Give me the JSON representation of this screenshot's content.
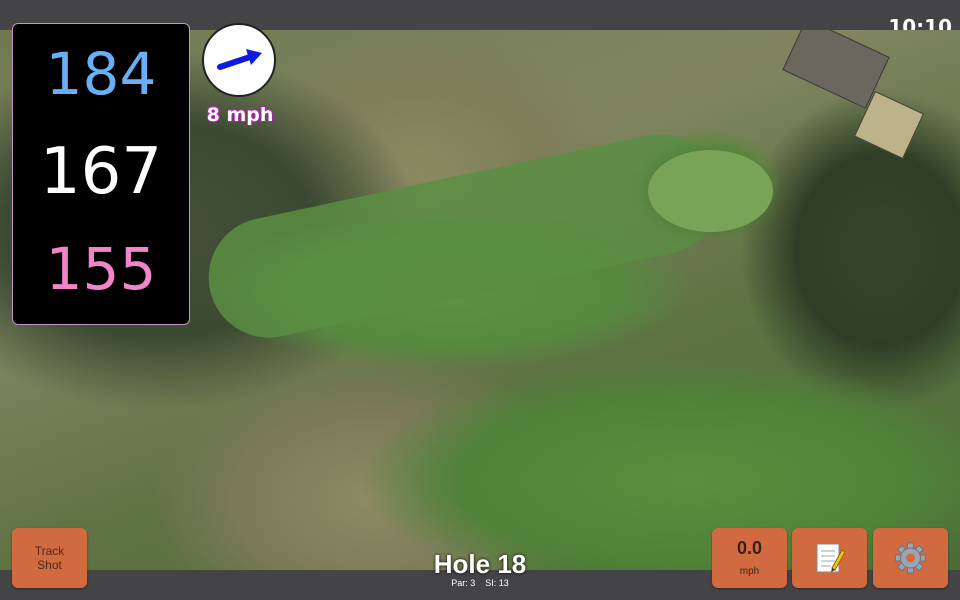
{
  "status_bar": {
    "time": "10:10"
  },
  "distances": {
    "back": "184",
    "center": "167",
    "front": "155"
  },
  "wind": {
    "speed": "8 mph",
    "direction_icon": "arrow-right-icon",
    "arrow_color": "#0b1de0"
  },
  "hole": {
    "title": "Hole 18",
    "par_label": "Par: 3",
    "si_label": "SI: 13"
  },
  "buttons": {
    "track_shot_line1": "Track",
    "track_shot_line2": "Shot",
    "speed_value": "0.0",
    "speed_unit": "mph",
    "notes_icon": "notepad-icon",
    "settings_icon": "gear-icon"
  },
  "colors": {
    "back": "#6aaef5",
    "center": "#ffffff",
    "front": "#f285c8",
    "button": "#d26a3f"
  }
}
